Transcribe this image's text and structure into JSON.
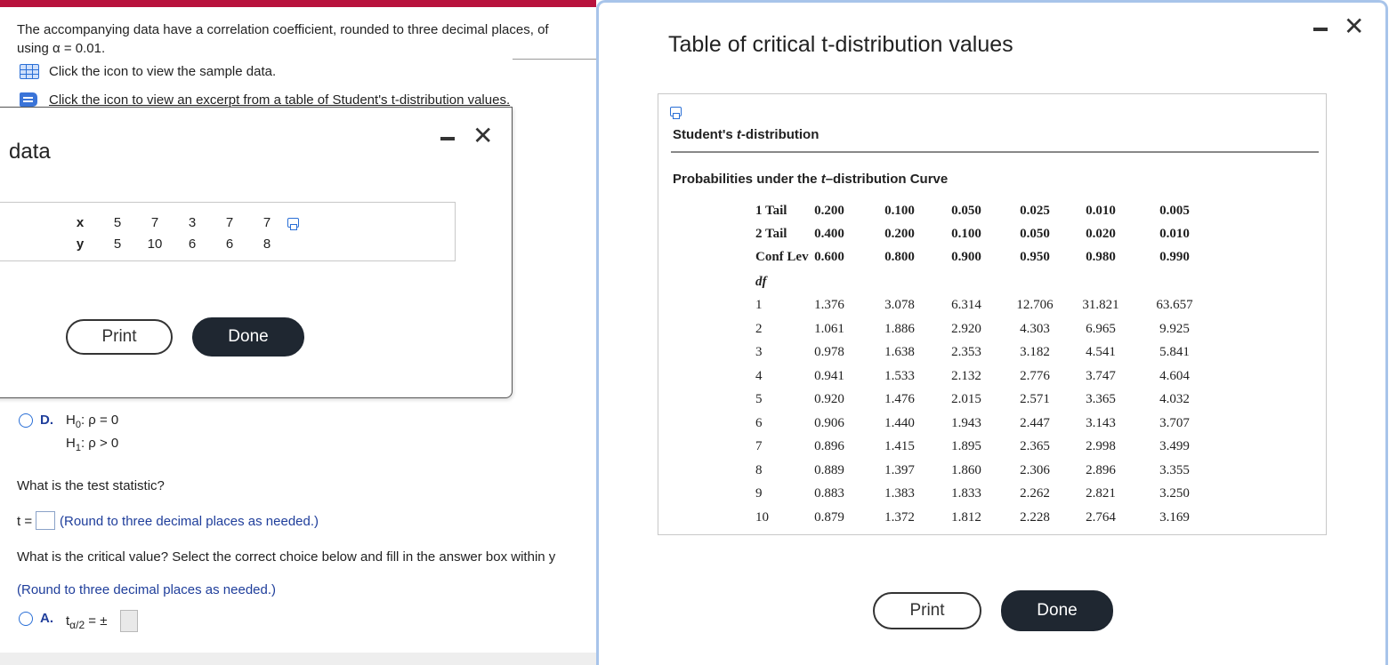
{
  "question": {
    "intro_line1": "The accompanying data have a correlation coefficient, rounded to three decimal places, of",
    "intro_line2": "using α = 0.01.",
    "data_link": "Click the icon to view the sample data.",
    "table_link": "Click the icon to view an excerpt from a table of Student's t-distribution values.",
    "option_d": {
      "letter": "D.",
      "h0_sym": "H",
      "h0_sub": "0",
      "h0_rel": ": ρ = 0",
      "h1_sym": "H",
      "h1_sub": "1",
      "h1_rel": ": ρ > 0"
    },
    "test_stat_q": "What is the test statistic?",
    "t_label": "t =",
    "round_note_1": "(Round to three decimal places as needed.)",
    "critical_q": "What is the critical value? Select the correct choice below and fill in the answer box within y",
    "round_note_2": "(Round to three decimal places as needed.)",
    "option_a": {
      "letter": "A.",
      "sym": "t",
      "sub": "α/2",
      "rel": " = ±"
    }
  },
  "data_dialog": {
    "title": "data",
    "rows": [
      {
        "label": "x",
        "values": [
          "5",
          "7",
          "3",
          "7",
          "7"
        ]
      },
      {
        "label": "y",
        "values": [
          "5",
          "10",
          "6",
          "6",
          "8"
        ]
      }
    ],
    "print_label": "Print",
    "done_label": "Done"
  },
  "table_dialog": {
    "title": "Table of critical t-distribution values",
    "subtitle_pre": "Student's ",
    "subtitle_t": "t",
    "subtitle_post": "-distribution",
    "prob_pre": "Probabilities under the ",
    "prob_t": "t",
    "prob_post": "–distribution Curve",
    "header_rows": [
      {
        "label": "1 Tail",
        "values": [
          "0.200",
          "0.100",
          "0.050",
          "0.025",
          "0.010",
          "0.005"
        ]
      },
      {
        "label": "2 Tail",
        "values": [
          "0.400",
          "0.200",
          "0.100",
          "0.050",
          "0.020",
          "0.010"
        ]
      },
      {
        "label": "Conf Lev",
        "values": [
          "0.600",
          "0.800",
          "0.900",
          "0.950",
          "0.980",
          "0.990"
        ]
      }
    ],
    "df_label": "df",
    "rows": [
      {
        "df": "1",
        "values": [
          "1.376",
          "3.078",
          "6.314",
          "12.706",
          "31.821",
          "63.657"
        ]
      },
      {
        "df": "2",
        "values": [
          "1.061",
          "1.886",
          "2.920",
          "4.303",
          "6.965",
          "9.925"
        ]
      },
      {
        "df": "3",
        "values": [
          "0.978",
          "1.638",
          "2.353",
          "3.182",
          "4.541",
          "5.841"
        ]
      },
      {
        "df": "4",
        "values": [
          "0.941",
          "1.533",
          "2.132",
          "2.776",
          "3.747",
          "4.604"
        ]
      },
      {
        "df": "5",
        "values": [
          "0.920",
          "1.476",
          "2.015",
          "2.571",
          "3.365",
          "4.032"
        ]
      },
      {
        "df": "6",
        "values": [
          "0.906",
          "1.440",
          "1.943",
          "2.447",
          "3.143",
          "3.707"
        ]
      },
      {
        "df": "7",
        "values": [
          "0.896",
          "1.415",
          "1.895",
          "2.365",
          "2.998",
          "3.499"
        ]
      },
      {
        "df": "8",
        "values": [
          "0.889",
          "1.397",
          "1.860",
          "2.306",
          "2.896",
          "3.355"
        ]
      },
      {
        "df": "9",
        "values": [
          "0.883",
          "1.383",
          "1.833",
          "2.262",
          "2.821",
          "3.250"
        ]
      },
      {
        "df": "10",
        "values": [
          "0.879",
          "1.372",
          "1.812",
          "2.228",
          "2.764",
          "3.169"
        ]
      }
    ],
    "print_label": "Print",
    "done_label": "Done"
  },
  "icons": {
    "minimize": "minimize-icon",
    "close": "close-icon",
    "copy": "copy-icon",
    "data_grid": "data-grid-icon",
    "table_book": "book-icon"
  },
  "colors": {
    "brand_bar": "#b8123d",
    "link_blue": "#1f3e9b",
    "accent_blue": "#2a6fd6",
    "dark_button": "#1f2731"
  }
}
